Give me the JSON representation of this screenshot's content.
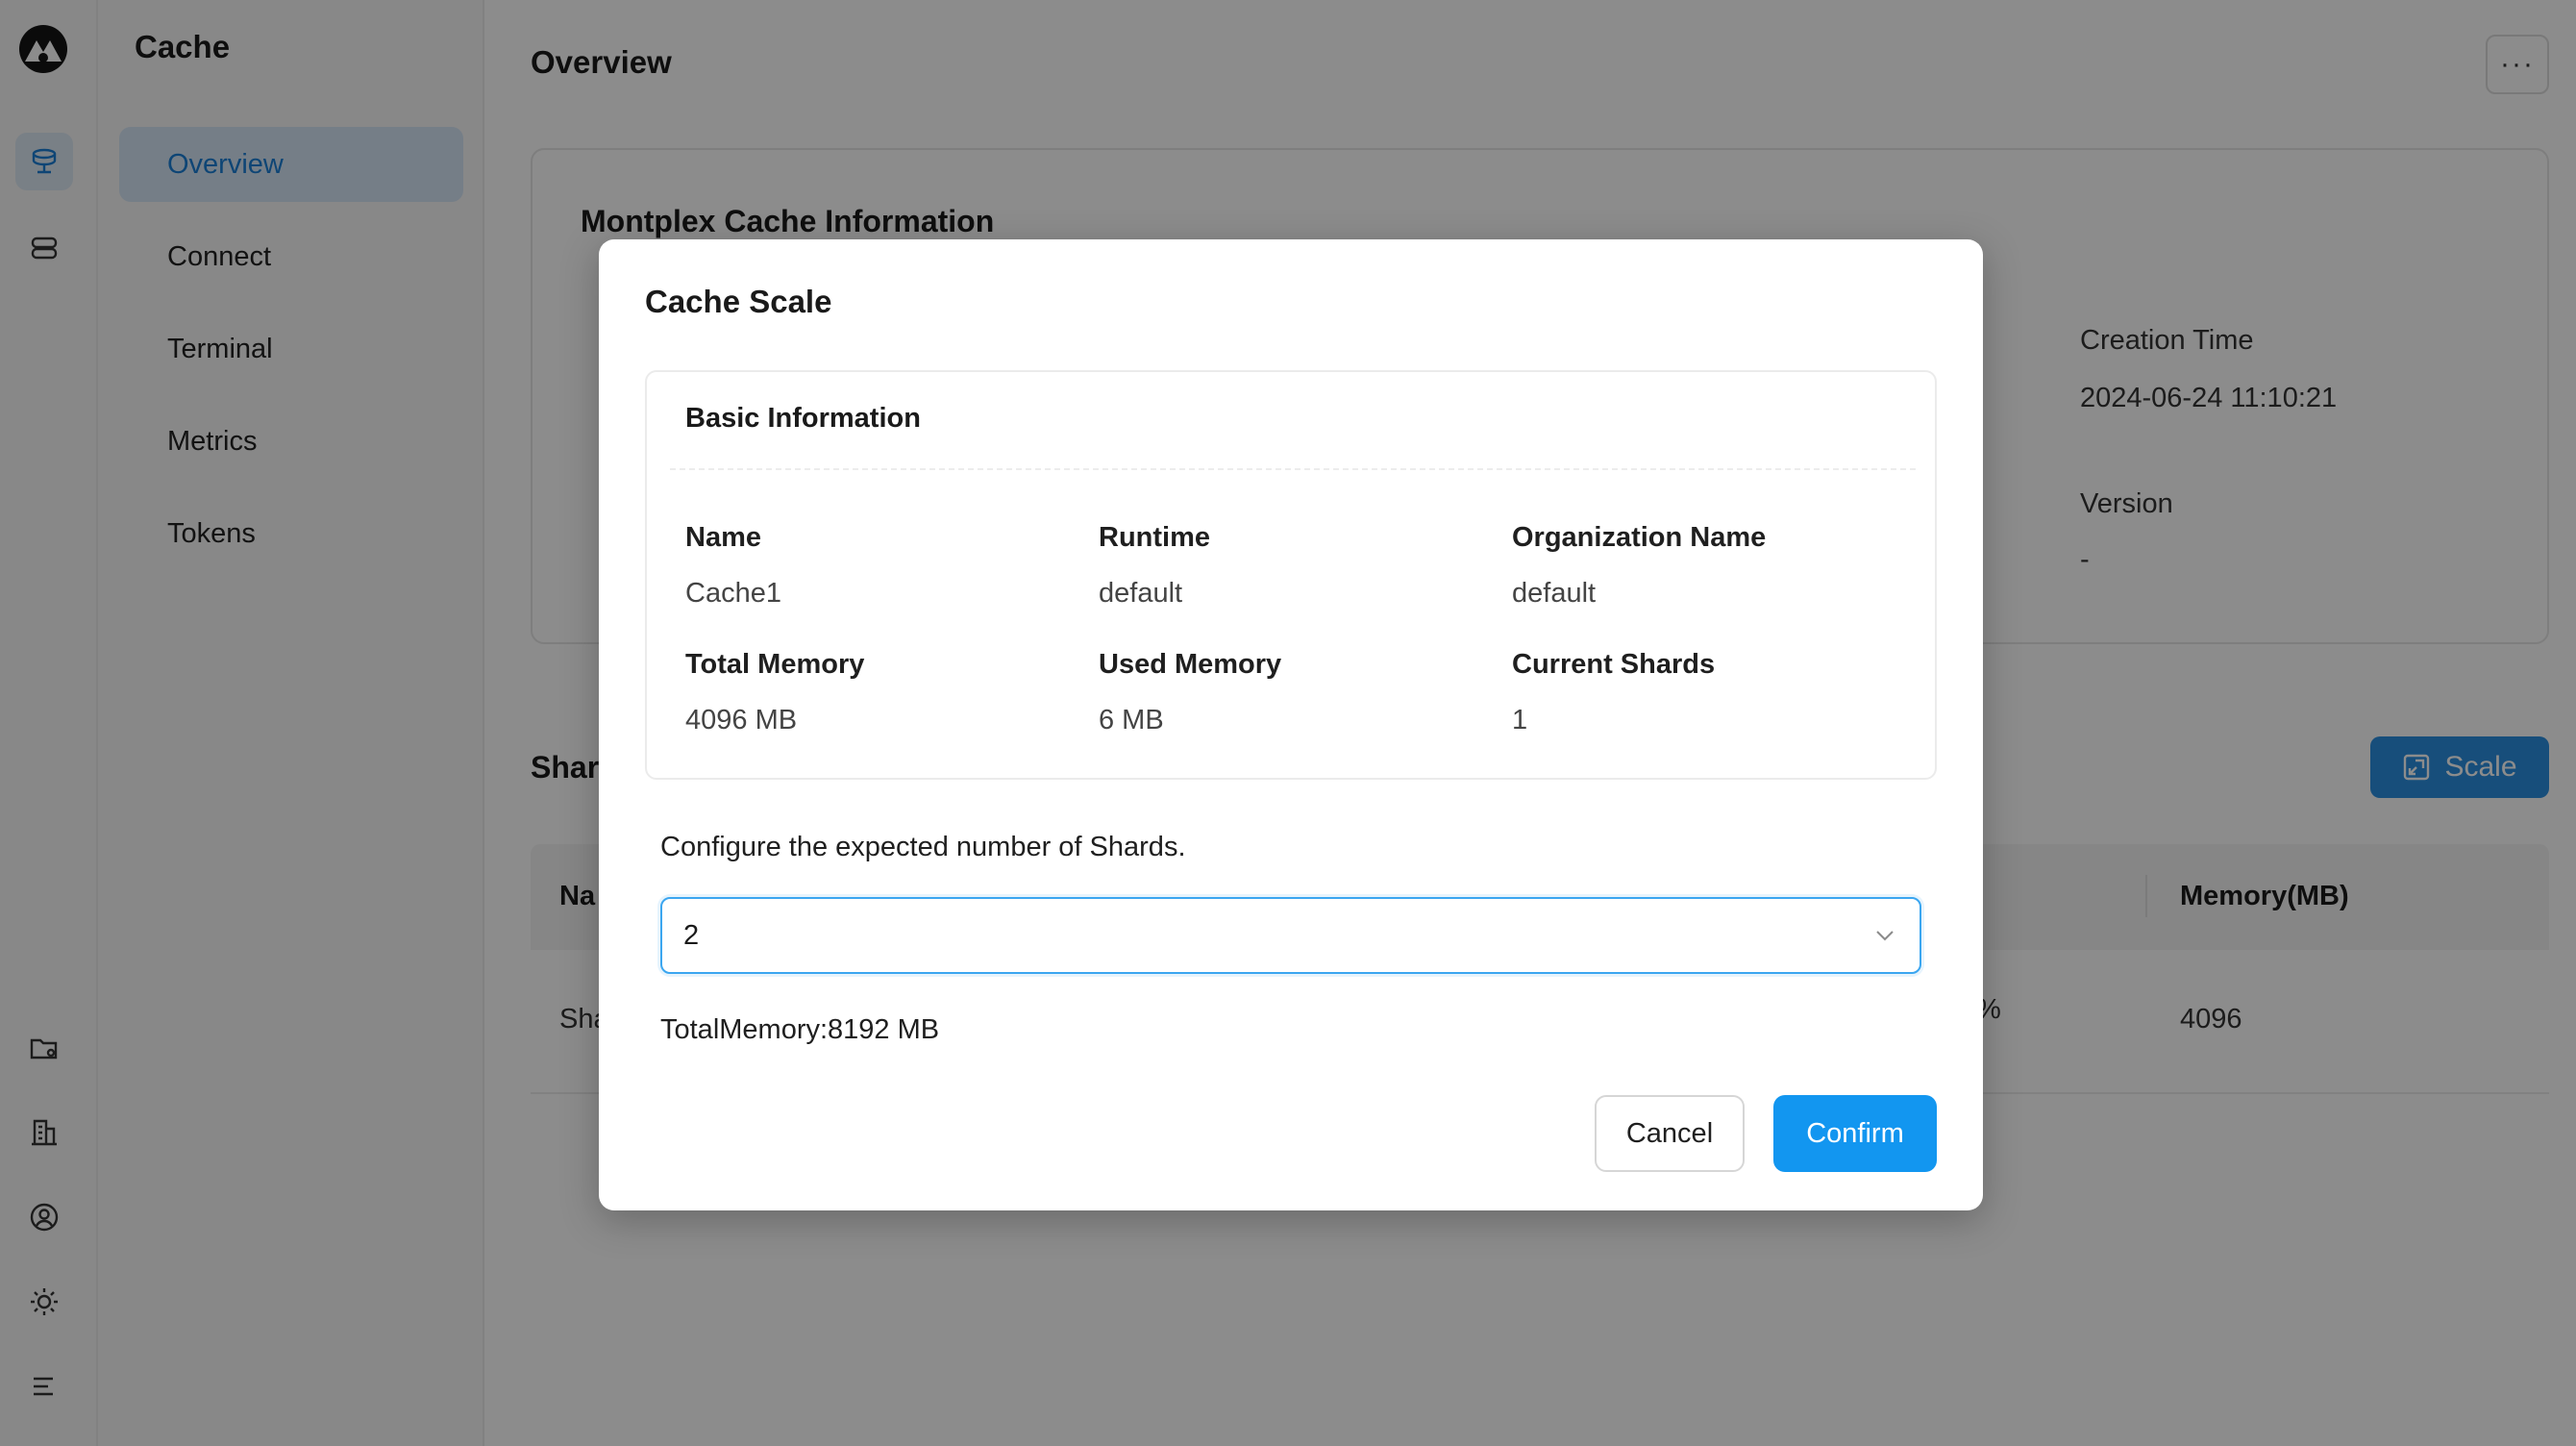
{
  "app": {
    "section_title": "Cache"
  },
  "rail": {
    "top_icons": [
      "cache-icon",
      "database-icon"
    ],
    "bottom_icons": [
      "folder-settings-icon",
      "building-icon",
      "user-circle-icon",
      "sun-icon",
      "menu-icon"
    ]
  },
  "subnav": {
    "items": [
      {
        "label": "Overview",
        "active": true
      },
      {
        "label": "Connect"
      },
      {
        "label": "Terminal"
      },
      {
        "label": "Metrics"
      },
      {
        "label": "Tokens"
      }
    ]
  },
  "page": {
    "title": "Overview",
    "more_label": "···",
    "info_card": {
      "title": "Montplex Cache Information",
      "creation_time_label": "Creation Time",
      "creation_time_value": "2024-06-24 11:10:21",
      "version_label": "Version",
      "version_value": "-"
    },
    "shards_title": "Shar",
    "scale_button": "Scale",
    "table": {
      "col_name": "Na",
      "col_memory": "Memory(MB)",
      "row_name": "Sha",
      "row_percent": "%",
      "row_memory": "4096"
    }
  },
  "modal": {
    "title": "Cache Scale",
    "basic_info": {
      "title": "Basic Information",
      "name_label": "Name",
      "name_value": "Cache1",
      "runtime_label": "Runtime",
      "runtime_value": "default",
      "org_label": "Organization Name",
      "org_value": "default",
      "total_memory_label": "Total Memory",
      "total_memory_value": "4096 MB",
      "used_memory_label": "Used Memory",
      "used_memory_value": "6 MB",
      "current_shards_label": "Current Shards",
      "current_shards_value": "1"
    },
    "configure_label": "Configure the expected number of Shards.",
    "shards_select_value": "2",
    "total_memory_text": "TotalMemory:8192 MB",
    "cancel_label": "Cancel",
    "confirm_label": "Confirm"
  },
  "colors": {
    "accent": "#1296f0",
    "active_nav_bg": "#d5e6f6",
    "active_nav_text": "#1a7fd6"
  }
}
